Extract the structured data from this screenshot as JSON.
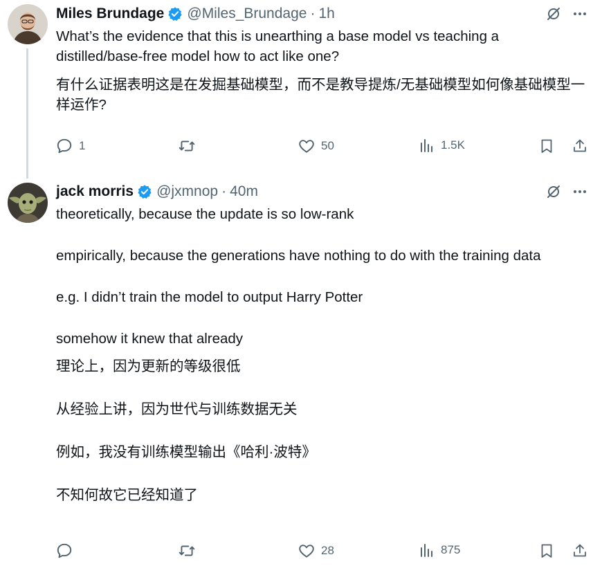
{
  "tweets": [
    {
      "author": "Miles Brundage",
      "handle": "@Miles_Brundage",
      "separator": "·",
      "time": "1h",
      "text_en": "What’s the evidence that this is unearthing a base model vs teaching a distilled/base-free model how to act like one?",
      "text_zh": "有什么证据表明这是在发掘基础模型，而不是教导提炼/无基础模型如何像基础模型一样运作?",
      "replies": "1",
      "retweets": "",
      "likes": "50",
      "views": "1.5K",
      "avatar_icon": "person-avatar-icon"
    },
    {
      "author": "jack morris",
      "handle": "@jxmnop",
      "separator": "·",
      "time": "40m",
      "paragraphs": [
        "theoretically, because the update is so low-rank",
        "empirically, because the generations have nothing to do with the training data",
        "e.g.  I didn’t train the model to output Harry Potter",
        "somehow it knew that already",
        "理论上，因为更新的等级很低",
        "从经验上讲，因为世代与训练数据无关",
        "例如，我没有训练模型输出《哈利·波特》",
        "不知何故它已经知道了"
      ],
      "replies": "",
      "retweets": "",
      "likes": "28",
      "views": "875",
      "avatar_icon": "yoda-avatar-icon"
    }
  ],
  "colors": {
    "text": "#0f1419",
    "secondary": "#536471",
    "verified": "#1d9bf0",
    "thread_line": "#cfd9de"
  }
}
